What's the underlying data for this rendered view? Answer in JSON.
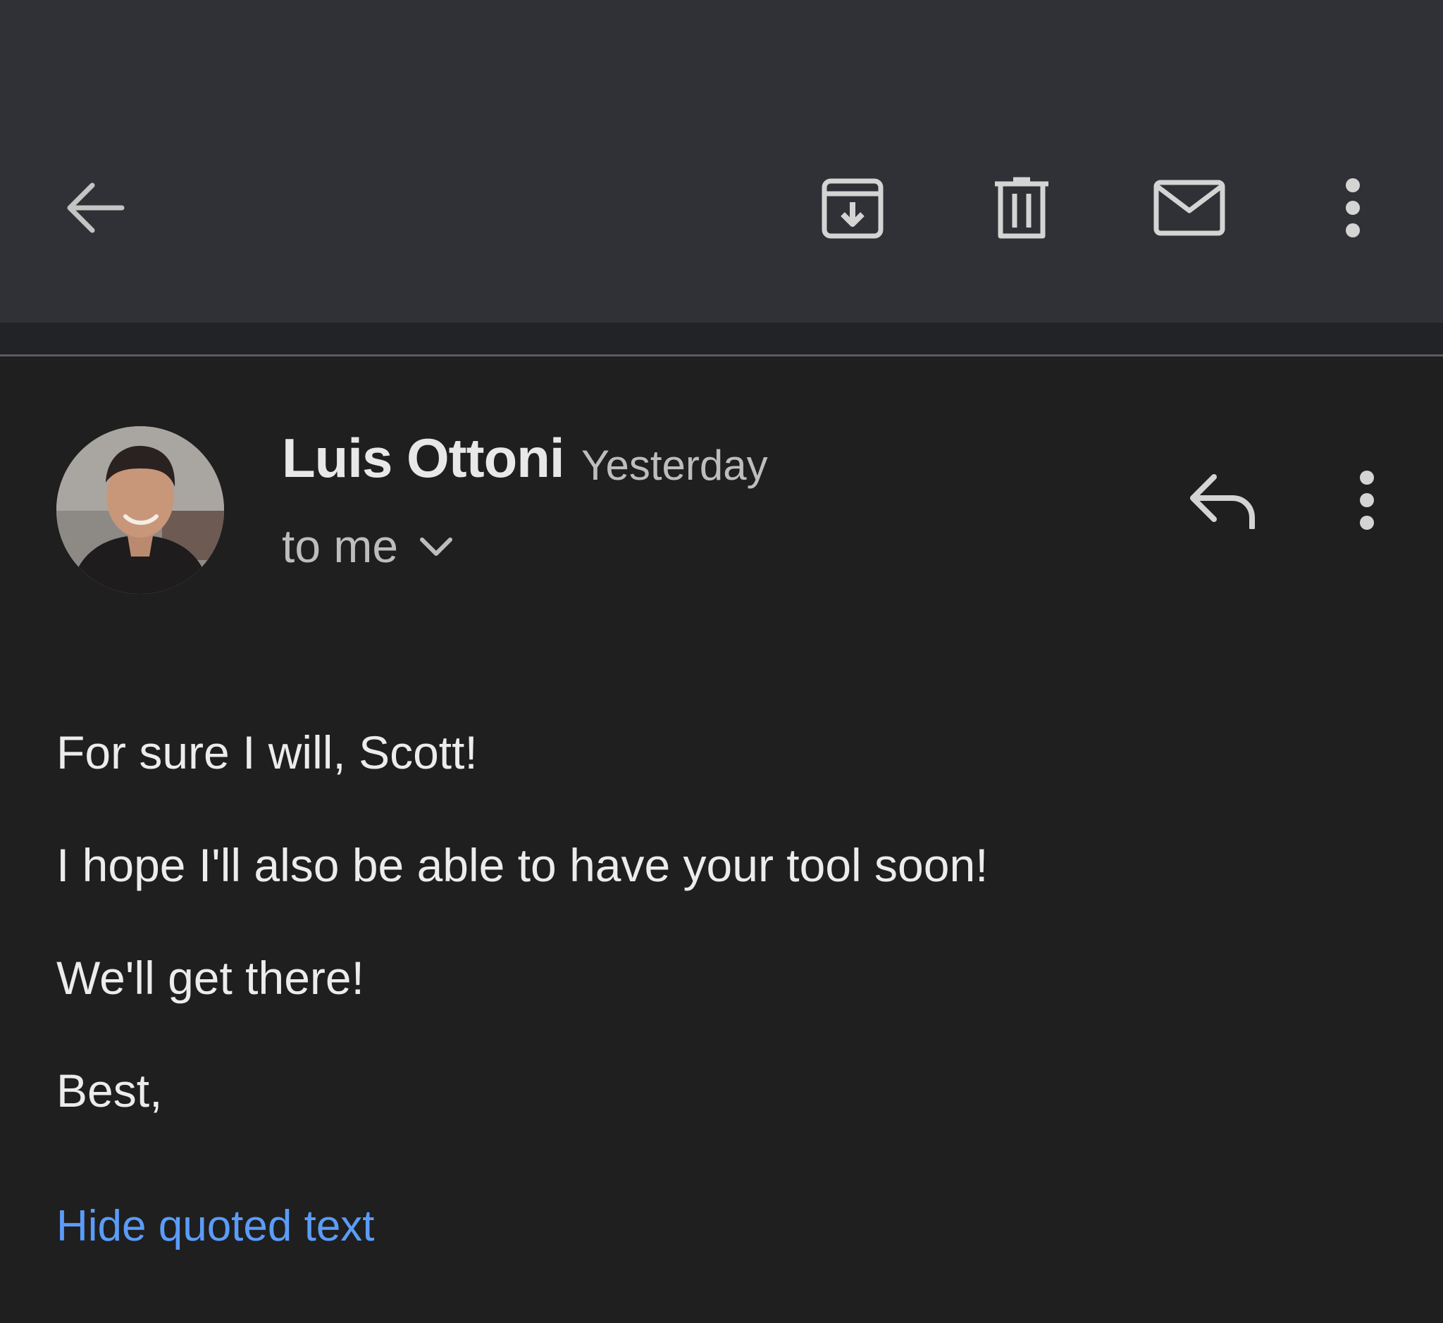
{
  "toolbar": {
    "icons": {
      "back": "arrow-left-icon",
      "archive": "archive-icon",
      "delete": "trash-icon",
      "mark_unread": "mail-icon",
      "more": "more-vertical-icon"
    }
  },
  "message": {
    "sender_name": "Luis Ottoni",
    "time": "Yesterday",
    "recipients_label": "to me",
    "icons": {
      "avatar": "avatar-photo",
      "recipients_toggle": "chevron-down-icon",
      "reply": "reply-icon",
      "more": "more-vertical-icon"
    },
    "body": [
      "For sure I will, Scott!",
      "I hope I'll also be able to have your tool soon!",
      "We'll get there!",
      "Best,"
    ],
    "quoted_text_toggle": "Hide quoted text"
  },
  "colors": {
    "toolbar_bg": "#303136",
    "content_bg": "#1f1f1f",
    "text_primary": "#ececec",
    "text_secondary": "#bdbdbd",
    "link": "#5b9cf8"
  }
}
